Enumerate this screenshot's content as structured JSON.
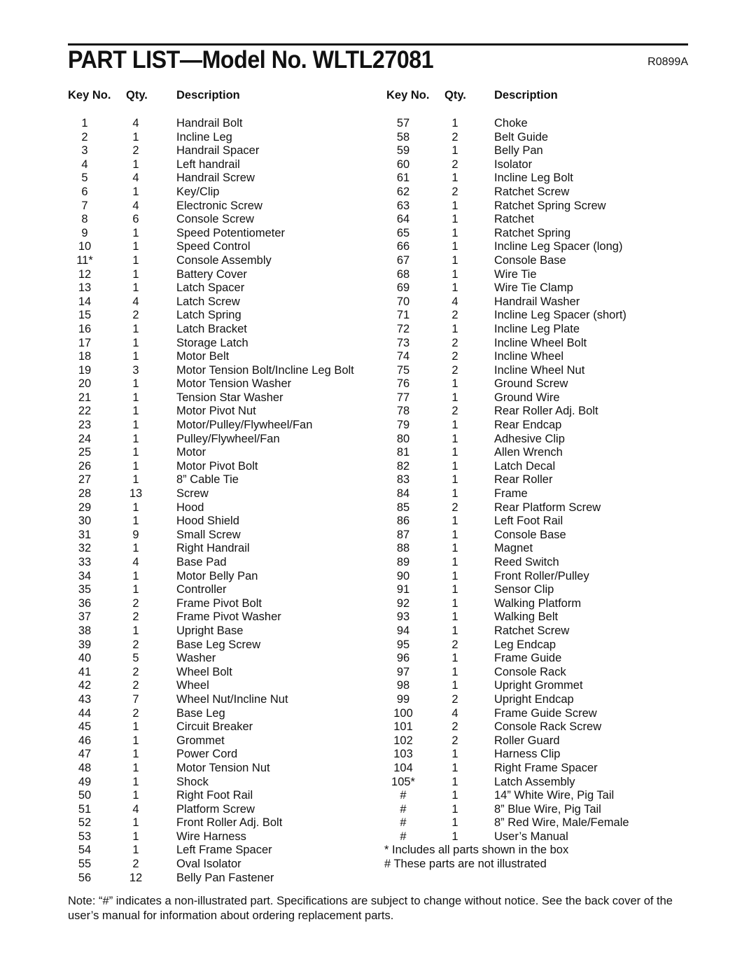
{
  "header": {
    "title": "PART LIST—Model No. WLTL27081",
    "code": "R0899A"
  },
  "columns": {
    "key": "Key No.",
    "qty": "Qty.",
    "desc": "Description"
  },
  "left_parts": [
    {
      "key": "1",
      "qty": "4",
      "desc": "Handrail Bolt"
    },
    {
      "key": "2",
      "qty": "1",
      "desc": "Incline Leg"
    },
    {
      "key": "3",
      "qty": "2",
      "desc": "Handrail Spacer"
    },
    {
      "key": "4",
      "qty": "1",
      "desc": "Left handrail"
    },
    {
      "key": "5",
      "qty": "4",
      "desc": "Handrail Screw"
    },
    {
      "key": "6",
      "qty": "1",
      "desc": "Key/Clip"
    },
    {
      "key": "7",
      "qty": "4",
      "desc": "Electronic Screw"
    },
    {
      "key": "8",
      "qty": "6",
      "desc": "Console Screw"
    },
    {
      "key": "9",
      "qty": "1",
      "desc": "Speed Potentiometer"
    },
    {
      "key": "10",
      "qty": "1",
      "desc": "Speed Control"
    },
    {
      "key": "11*",
      "qty": "1",
      "desc": "Console Assembly"
    },
    {
      "key": "12",
      "qty": "1",
      "desc": "Battery Cover"
    },
    {
      "key": "13",
      "qty": "1",
      "desc": "Latch Spacer"
    },
    {
      "key": "14",
      "qty": "4",
      "desc": "Latch Screw"
    },
    {
      "key": "15",
      "qty": "2",
      "desc": "Latch Spring"
    },
    {
      "key": "16",
      "qty": "1",
      "desc": "Latch Bracket"
    },
    {
      "key": "17",
      "qty": "1",
      "desc": "Storage Latch"
    },
    {
      "key": "18",
      "qty": "1",
      "desc": "Motor Belt"
    },
    {
      "key": "19",
      "qty": "3",
      "desc": "Motor Tension Bolt/Incline Leg Bolt"
    },
    {
      "key": "20",
      "qty": "1",
      "desc": "Motor Tension Washer"
    },
    {
      "key": "21",
      "qty": "1",
      "desc": "Tension Star Washer"
    },
    {
      "key": "22",
      "qty": "1",
      "desc": "Motor Pivot Nut"
    },
    {
      "key": "23",
      "qty": "1",
      "desc": "Motor/Pulley/Flywheel/Fan"
    },
    {
      "key": "24",
      "qty": "1",
      "desc": "Pulley/Flywheel/Fan"
    },
    {
      "key": "25",
      "qty": "1",
      "desc": "Motor"
    },
    {
      "key": "26",
      "qty": "1",
      "desc": "Motor Pivot Bolt"
    },
    {
      "key": "27",
      "qty": "1",
      "desc": "8” Cable Tie"
    },
    {
      "key": "28",
      "qty": "13",
      "desc": "Screw"
    },
    {
      "key": "29",
      "qty": "1",
      "desc": "Hood"
    },
    {
      "key": "30",
      "qty": "1",
      "desc": "Hood Shield"
    },
    {
      "key": "31",
      "qty": "9",
      "desc": "Small Screw"
    },
    {
      "key": "32",
      "qty": "1",
      "desc": "Right Handrail"
    },
    {
      "key": "33",
      "qty": "4",
      "desc": "Base Pad"
    },
    {
      "key": "34",
      "qty": "1",
      "desc": "Motor Belly Pan"
    },
    {
      "key": "35",
      "qty": "1",
      "desc": "Controller"
    },
    {
      "key": "36",
      "qty": "2",
      "desc": "Frame Pivot Bolt"
    },
    {
      "key": "37",
      "qty": "2",
      "desc": "Frame Pivot Washer"
    },
    {
      "key": "38",
      "qty": "1",
      "desc": "Upright Base"
    },
    {
      "key": "39",
      "qty": "2",
      "desc": "Base Leg Screw"
    },
    {
      "key": "40",
      "qty": "5",
      "desc": "Washer"
    },
    {
      "key": "41",
      "qty": "2",
      "desc": "Wheel Bolt"
    },
    {
      "key": "42",
      "qty": "2",
      "desc": "Wheel"
    },
    {
      "key": "43",
      "qty": "7",
      "desc": "Wheel Nut/Incline Nut"
    },
    {
      "key": "44",
      "qty": "2",
      "desc": "Base Leg"
    },
    {
      "key": "45",
      "qty": "1",
      "desc": "Circuit Breaker"
    },
    {
      "key": "46",
      "qty": "1",
      "desc": "Grommet"
    },
    {
      "key": "47",
      "qty": "1",
      "desc": "Power Cord"
    },
    {
      "key": "48",
      "qty": "1",
      "desc": "Motor Tension Nut"
    },
    {
      "key": "49",
      "qty": "1",
      "desc": "Shock"
    },
    {
      "key": "50",
      "qty": "1",
      "desc": "Right Foot Rail"
    },
    {
      "key": "51",
      "qty": "4",
      "desc": "Platform Screw"
    },
    {
      "key": "52",
      "qty": "1",
      "desc": "Front Roller Adj. Bolt"
    },
    {
      "key": "53",
      "qty": "1",
      "desc": "Wire Harness"
    },
    {
      "key": "54",
      "qty": "1",
      "desc": "Left Frame Spacer"
    },
    {
      "key": "55",
      "qty": "2",
      "desc": "Oval Isolator"
    },
    {
      "key": "56",
      "qty": "12",
      "desc": "Belly Pan Fastener"
    }
  ],
  "right_parts": [
    {
      "key": "57",
      "qty": "1",
      "desc": "Choke"
    },
    {
      "key": "58",
      "qty": "2",
      "desc": "Belt Guide"
    },
    {
      "key": "59",
      "qty": "1",
      "desc": "Belly Pan"
    },
    {
      "key": "60",
      "qty": "2",
      "desc": "Isolator"
    },
    {
      "key": "61",
      "qty": "1",
      "desc": "Incline Leg Bolt"
    },
    {
      "key": "62",
      "qty": "2",
      "desc": "Ratchet Screw"
    },
    {
      "key": "63",
      "qty": "1",
      "desc": "Ratchet Spring Screw"
    },
    {
      "key": "64",
      "qty": "1",
      "desc": "Ratchet"
    },
    {
      "key": "65",
      "qty": "1",
      "desc": "Ratchet Spring"
    },
    {
      "key": "66",
      "qty": "1",
      "desc": "Incline Leg Spacer (long)"
    },
    {
      "key": "67",
      "qty": "1",
      "desc": "Console Base"
    },
    {
      "key": "68",
      "qty": "1",
      "desc": "Wire Tie"
    },
    {
      "key": "69",
      "qty": "1",
      "desc": "Wire Tie Clamp"
    },
    {
      "key": "70",
      "qty": "4",
      "desc": "Handrail Washer"
    },
    {
      "key": "71",
      "qty": "2",
      "desc": "Incline Leg Spacer (short)"
    },
    {
      "key": "72",
      "qty": "1",
      "desc": "Incline Leg Plate"
    },
    {
      "key": "73",
      "qty": "2",
      "desc": "Incline Wheel Bolt"
    },
    {
      "key": "74",
      "qty": "2",
      "desc": "Incline Wheel"
    },
    {
      "key": "75",
      "qty": "2",
      "desc": "Incline Wheel Nut"
    },
    {
      "key": "76",
      "qty": "1",
      "desc": "Ground Screw"
    },
    {
      "key": "77",
      "qty": "1",
      "desc": "Ground Wire"
    },
    {
      "key": "78",
      "qty": "2",
      "desc": "Rear Roller Adj. Bolt"
    },
    {
      "key": "79",
      "qty": "1",
      "desc": "Rear Endcap"
    },
    {
      "key": "80",
      "qty": "1",
      "desc": "Adhesive Clip"
    },
    {
      "key": "81",
      "qty": "1",
      "desc": "Allen Wrench"
    },
    {
      "key": "82",
      "qty": "1",
      "desc": "Latch Decal"
    },
    {
      "key": "83",
      "qty": "1",
      "desc": "Rear Roller"
    },
    {
      "key": "84",
      "qty": "1",
      "desc": "Frame"
    },
    {
      "key": "85",
      "qty": "2",
      "desc": "Rear Platform Screw"
    },
    {
      "key": "86",
      "qty": "1",
      "desc": "Left Foot Rail"
    },
    {
      "key": "87",
      "qty": "1",
      "desc": "Console Base"
    },
    {
      "key": "88",
      "qty": "1",
      "desc": "Magnet"
    },
    {
      "key": "89",
      "qty": "1",
      "desc": "Reed Switch"
    },
    {
      "key": "90",
      "qty": "1",
      "desc": "Front Roller/Pulley"
    },
    {
      "key": "91",
      "qty": "1",
      "desc": "Sensor Clip"
    },
    {
      "key": "92",
      "qty": "1",
      "desc": "Walking Platform"
    },
    {
      "key": "93",
      "qty": "1",
      "desc": "Walking Belt"
    },
    {
      "key": "94",
      "qty": "1",
      "desc": "Ratchet Screw"
    },
    {
      "key": "95",
      "qty": "2",
      "desc": "Leg Endcap"
    },
    {
      "key": "96",
      "qty": "1",
      "desc": "Frame Guide"
    },
    {
      "key": "97",
      "qty": "1",
      "desc": "Console Rack"
    },
    {
      "key": "98",
      "qty": "1",
      "desc": "Upright Grommet"
    },
    {
      "key": "99",
      "qty": "2",
      "desc": "Upright Endcap"
    },
    {
      "key": "100",
      "qty": "4",
      "desc": "Frame Guide Screw"
    },
    {
      "key": "101",
      "qty": "2",
      "desc": "Console Rack Screw"
    },
    {
      "key": "102",
      "qty": "2",
      "desc": "Roller Guard"
    },
    {
      "key": "103",
      "qty": "1",
      "desc": "Harness Clip"
    },
    {
      "key": "104",
      "qty": "1",
      "desc": "Right Frame Spacer"
    },
    {
      "key": "105*",
      "qty": "1",
      "desc": "Latch Assembly"
    },
    {
      "key": "#",
      "qty": "1",
      "desc": "14” White Wire, Pig Tail"
    },
    {
      "key": "#",
      "qty": "1",
      "desc": "8” Blue Wire, Pig Tail"
    },
    {
      "key": "#",
      "qty": "1",
      "desc": "8” Red Wire, Male/Female"
    },
    {
      "key": "#",
      "qty": "1",
      "desc": "User’s Manual"
    }
  ],
  "footnotes": [
    "* Includes all parts shown in the box",
    "# These parts are not illustrated"
  ],
  "note": "Note: “#” indicates a non-illustrated part. Specifications are subject to change without notice. See the back cover of the user’s manual for information about ordering replacement parts."
}
